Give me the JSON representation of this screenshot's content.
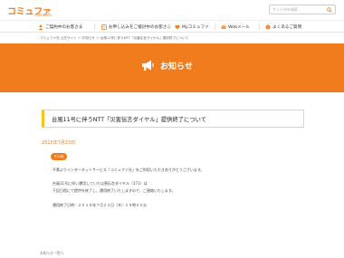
{
  "header": {
    "logo_main": "コミュファ",
    "logo_sub": "commufa",
    "search_placeholder": "サイト内を検索"
  },
  "nav": {
    "items": [
      {
        "label": "ご契約中のお客さま"
      },
      {
        "label": "お申し込みをご検討中のお客さま"
      },
      {
        "label": "Myコミュファ"
      },
      {
        "label": "Webメール"
      },
      {
        "label": "よくあるご質問"
      }
    ]
  },
  "breadcrumb": "コミュファ光 公式サイト ＞ お知らせ ＞ 台風11号に伴うNTT「災害伝言ダイヤル」提供終了について",
  "banner": {
    "title": "お知らせ"
  },
  "article": {
    "title": "台風11号に伴うNTT「災害伝言ダイヤル」提供終了について",
    "date": "2015年7月23日",
    "badge": "その他",
    "lines": [
      "平素よりインターネットサービス「コミュファ光」をご利用いただきありがとうございます。",
      "台風11号に伴い運用していた災害伝言ダイヤル（171）は",
      "下記日程にて提供を終了し、運用終了いたしますので、ご連絡いたします。",
      "運用終了日時：２０１５年７月２３日（木）１５時００分"
    ]
  },
  "footer": {
    "text": "お知らせ一覧へ"
  },
  "colors": {
    "brand": "#f07c1e",
    "accent": "#f5c51b"
  }
}
